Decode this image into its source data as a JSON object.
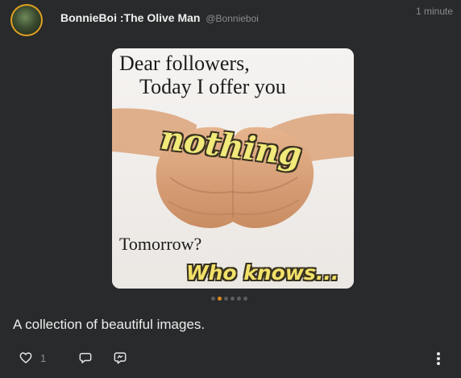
{
  "post": {
    "display_name": "BonnieBoi :The Olive Man",
    "handle": "@Bonnieboi",
    "timestamp": "1 minute",
    "caption": "A collection of beautiful images.",
    "like_count": "1"
  },
  "image": {
    "line1": "Dear followers,",
    "line2": "Today I offer you",
    "highlight": "nothing",
    "line3": "Tomorrow?",
    "line4": "Who knows..."
  },
  "carousel": {
    "count": 6,
    "active": 1
  },
  "icons": {
    "like": "heart-icon",
    "reply": "speech-bubble-icon",
    "boost": "quote-bubble-icon",
    "more": "vertical-ellipsis-icon"
  },
  "colors": {
    "background": "#282a2b",
    "avatar_ring": "#e0a020",
    "carousel_active": "#e08a1e"
  }
}
